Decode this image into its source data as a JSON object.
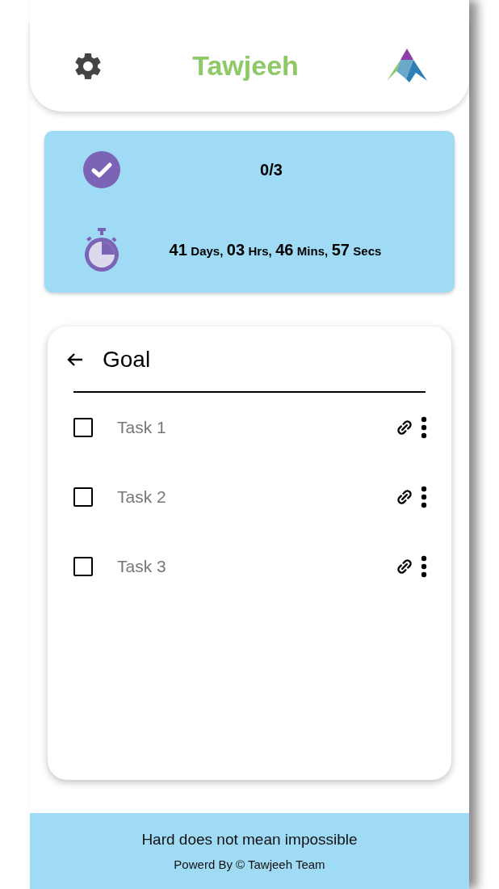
{
  "header": {
    "title": "Tawjeeh"
  },
  "stats": {
    "progress": "0/3",
    "countdown": [
      {
        "number": "41",
        "unit": "Days,"
      },
      {
        "number": "03",
        "unit": "Hrs,"
      },
      {
        "number": "46",
        "unit": "Mins,"
      },
      {
        "number": "57",
        "unit": "Secs"
      }
    ]
  },
  "goal": {
    "title": "Goal",
    "tasks": [
      {
        "label": "Task 1",
        "checked": false
      },
      {
        "label": "Task 2",
        "checked": false
      },
      {
        "label": "Task 3",
        "checked": false
      }
    ]
  },
  "footer": {
    "quote": "Hard does not mean impossible",
    "credit": "Powerd By © Tawjeeh Team"
  }
}
